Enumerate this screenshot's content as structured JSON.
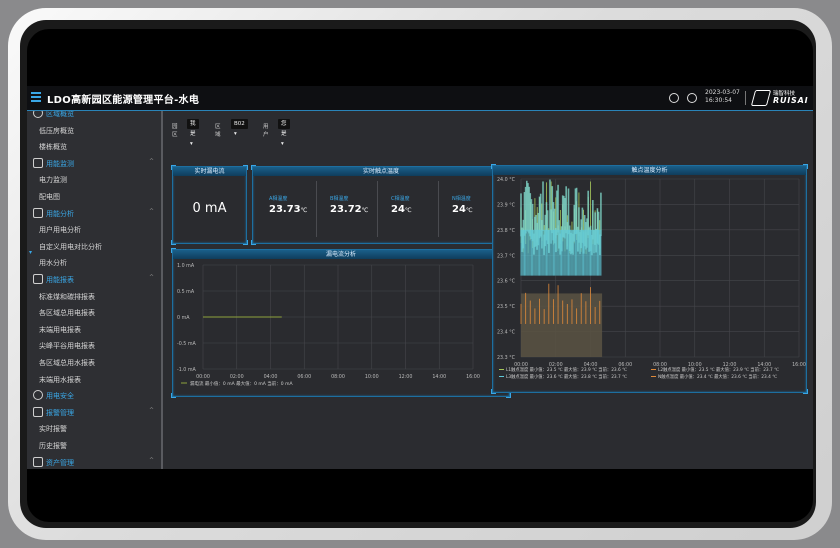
{
  "header": {
    "title": "LDO高新园区能源管理平台-水电",
    "date": "2023-03-07",
    "time": "16:30:54",
    "logo_cn": "瑞智科技",
    "logo_en": "RUISAI",
    "accent": "#3aa7e6"
  },
  "sidebar": {
    "sections": [
      {
        "label": "区域概览",
        "icon": "clock-icon",
        "items": [
          "低压房概览",
          "楼栋概览"
        ]
      },
      {
        "label": "用能监测",
        "icon": "monitor-icon",
        "items": [
          "电力监测",
          "配电图"
        ]
      },
      {
        "label": "用能分析",
        "icon": "chart-icon",
        "items": [
          "用户用电分析",
          "自定义用电对比分析",
          "用水分析"
        ]
      },
      {
        "label": "用能报表",
        "icon": "database-icon",
        "items": [
          "标准煤和碳排报表",
          "各区域总用电报表",
          "末端用电报表",
          "尖峰平谷用电报表",
          "各区域总用水报表",
          "末端用水报表"
        ]
      },
      {
        "label": "用电安全",
        "icon": "shield-icon",
        "items": []
      },
      {
        "label": "报警管理",
        "icon": "link-icon",
        "items": [
          "实时报警",
          "历史报警"
        ]
      },
      {
        "label": "资产管理",
        "icon": "database-icon",
        "items": []
      }
    ]
  },
  "filters": {
    "area_label": "园区",
    "area_value": "我是",
    "zone_label": "区域",
    "zone_value": "B02",
    "user_label": "用户",
    "user_value": "您是"
  },
  "panels": {
    "leak_title": "实时漏电流",
    "leak_value": "0 mA",
    "temp_title": "实时触点温度",
    "temps": [
      {
        "label": "A相温度",
        "value": "23.73",
        "unit": "℃"
      },
      {
        "label": "B相温度",
        "value": "23.72",
        "unit": "℃"
      },
      {
        "label": "C相温度",
        "value": "24",
        "unit": "℃"
      },
      {
        "label": "N相温度",
        "value": "24",
        "unit": "℃"
      }
    ],
    "leak_chart_title": "漏电流分析",
    "contact_chart_title": "触点温度分析"
  },
  "chart_data": [
    {
      "type": "line",
      "title": "漏电流分析",
      "x": [
        "00:00",
        "02:00",
        "04:00",
        "06:00",
        "08:00",
        "10:00",
        "12:00",
        "14:00",
        "16:00"
      ],
      "y_ticks": [
        "1.0 mA",
        "0.5 mA",
        "0 mA",
        "-0.5 mA",
        "-1.0 mA"
      ],
      "ylim": [
        -1.0,
        1.0
      ],
      "series": [
        {
          "name": "漏电流",
          "color": "#8fa33c",
          "x_range": [
            "00:00",
            "04:40"
          ],
          "value": 0
        }
      ],
      "legend": [
        {
          "name": "漏电流",
          "color": "#8fa33c",
          "text": "漏电流  最小值：0 mA  最大值：0 mA  当前：0 mA"
        }
      ],
      "grid": true,
      "legend_placement": "bottom"
    },
    {
      "type": "area",
      "title": "触点温度分析",
      "x": [
        "00:00",
        "02:00",
        "04:00",
        "06:00",
        "08:00",
        "10:00",
        "12:00",
        "14:00",
        "16:00"
      ],
      "y_ticks": [
        "24.0 °C",
        "23.9 °C",
        "23.8 °C",
        "23.7 °C",
        "23.6 °C",
        "23.5 °C",
        "23.4 °C",
        "23.3 °C"
      ],
      "ylim": [
        23.3,
        24.0
      ],
      "series": [
        {
          "name": "L1 触点温度",
          "color": "#a6c85a",
          "x_range": [
            "00:00",
            "04:40"
          ],
          "min": 23.5,
          "max": 23.9,
          "current": 23.6
        },
        {
          "name": "L2 触点温度",
          "color": "#7fd6c8",
          "x_range": [
            "00:00",
            "04:40"
          ],
          "min": 23.5,
          "max": 23.9,
          "current": 23.7
        },
        {
          "name": "L3 触点温度",
          "color": "#5fc9d8",
          "x_range": [
            "00:00",
            "04:40"
          ],
          "min": 23.6,
          "max": 23.8,
          "current": 23.7
        },
        {
          "name": "N 触点温度",
          "color": "#e08a3a",
          "x_range": [
            "00:00",
            "04:40"
          ],
          "min": 23.4,
          "max": 23.6,
          "current": 23.4
        }
      ],
      "legend": [
        {
          "name": "L1 触点温度",
          "color": "#a6c85a",
          "text": "L1触点温度  最小值：23.5 ℃  最大值：23.9 ℃  当前：23.6 ℃"
        },
        {
          "name": "L2 触点温度",
          "color": "#e08a3a",
          "text": "L2触点温度  最小值：23.5 ℃  最大值：23.9 ℃  当前：23.7 ℃"
        },
        {
          "name": "L3 触点温度",
          "color": "#5fc9d8",
          "text": "L3触点温度  最小值：23.6 ℃  最大值：23.8 ℃  当前：23.7 ℃"
        },
        {
          "name": "N 触点温度",
          "color": "#e08a3a",
          "text": "N触点温度  最小值：23.4 ℃  最大值：23.6 ℃  当前：23.4 ℃"
        }
      ],
      "grid": true,
      "legend_placement": "bottom"
    }
  ]
}
